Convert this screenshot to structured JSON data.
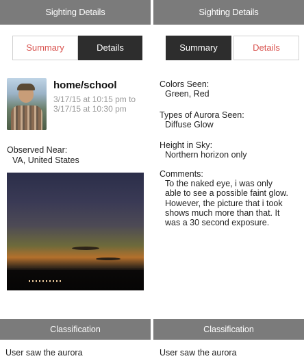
{
  "left_panel": {
    "header_title": "Sighting Details",
    "tabs": {
      "summary_label": "Summary",
      "details_label": "Details",
      "active": "Details"
    },
    "location_title": "home/school",
    "time_line_1": "3/17/15 at 10:15 pm to",
    "time_line_2": "3/17/15 at 10:30 pm",
    "observed_near_label": "Observed Near:",
    "observed_near_value": "VA, United States",
    "classification_title": "Classification",
    "classification_value": "User saw the aurora"
  },
  "right_panel": {
    "header_title": "Sighting Details",
    "tabs": {
      "summary_label": "Summary",
      "details_label": "Details",
      "active": "Summary"
    },
    "colors_seen_label": "Colors Seen:",
    "colors_seen_value": "Green, Red",
    "types_label": "Types of Aurora Seen:",
    "types_value": "Diffuse Glow",
    "height_label": "Height in Sky:",
    "height_value": "Northern horizon only",
    "comments_label": "Comments:",
    "comments_lines": [
      "To the naked eye, i was only",
      "able to see a possible faint glow.",
      "However, the picture that i took",
      "shows much more than that. It",
      "was a 30 second exposure."
    ],
    "classification_title": "Classification",
    "classification_value": "User saw the aurora"
  },
  "colors": {
    "header_bg": "#7b7b7b",
    "accent_red": "#d9534f",
    "active_tab_bg": "#2d2d2d",
    "top_accent": "#9fc1df"
  }
}
